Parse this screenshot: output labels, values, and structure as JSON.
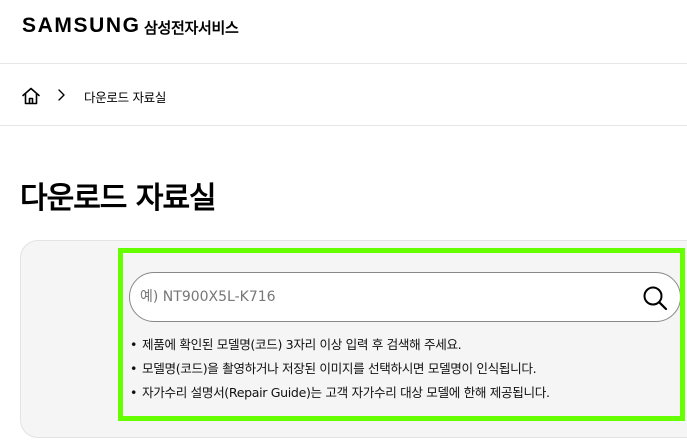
{
  "header": {
    "brand": "SAMSUNG",
    "service_name": "삼성전자서비스"
  },
  "breadcrumb": {
    "home_icon": "home-icon",
    "separator_icon": "chevron-right-icon",
    "current": "다운로드 자료실"
  },
  "page": {
    "title": "다운로드 자료실"
  },
  "search": {
    "placeholder": "예) NT900X5L-K716",
    "value": "",
    "button_icon": "search-icon",
    "notes": [
      "제품에 확인된 모델명(코드) 3자리 이상 입력 후 검색해 주세요.",
      "모델명(코드)을 촬영하거나 저장된 이미지를 선택하시면 모델명이 인식됩니다.",
      "자가수리 설명서(Repair Guide)는 고객 자가수리 대상 모델에 한해 제공됩니다."
    ]
  },
  "colors": {
    "highlight": "#66ff00",
    "card_background": "#f5f5f5",
    "input_border": "#888888"
  }
}
